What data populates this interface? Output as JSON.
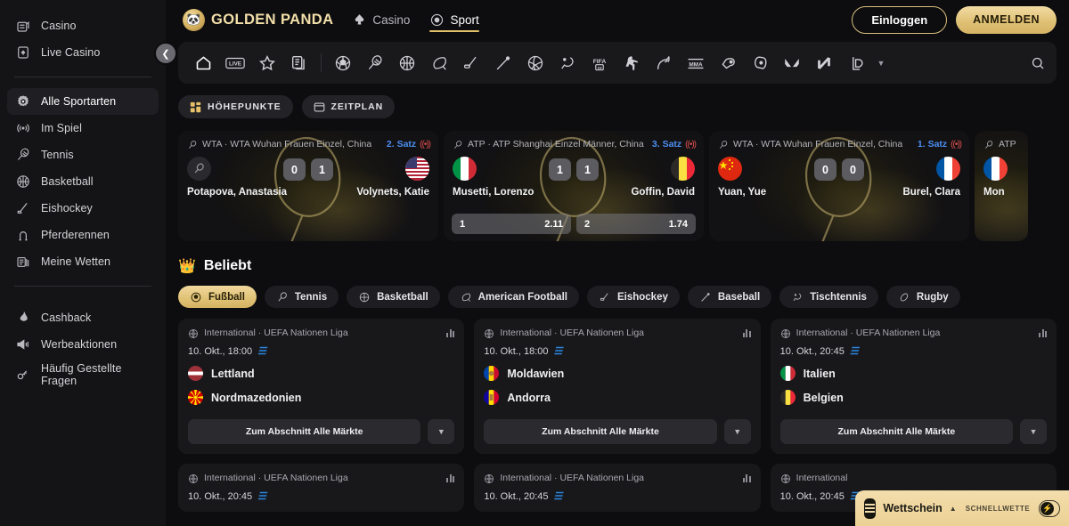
{
  "brand": {
    "name": "GOLDEN PANDA",
    "mark_icon": "panda-icon"
  },
  "topnav": [
    {
      "label": "Casino",
      "icon": "spade-icon",
      "selected": false
    },
    {
      "label": "Sport",
      "icon": "sport-target-icon",
      "selected": true
    }
  ],
  "auth": {
    "login": "Einloggen",
    "register": "ANMELDEN"
  },
  "sidebar": {
    "top": [
      {
        "label": "Casino",
        "icon": "slot-machine-icon"
      },
      {
        "label": "Live Casino",
        "icon": "spade-card-icon"
      }
    ],
    "sports": [
      {
        "label": "Alle Sportarten",
        "icon": "all-sports-icon",
        "active": true
      },
      {
        "label": "Im Spiel",
        "icon": "live-broadcast-icon",
        "active": false
      },
      {
        "label": "Tennis",
        "icon": "tennis-racket-icon",
        "active": false
      },
      {
        "label": "Basketball",
        "icon": "basketball-icon",
        "active": false
      },
      {
        "label": "Eishockey",
        "icon": "ice-hockey-icon",
        "active": false
      },
      {
        "label": "Pferderennen",
        "icon": "horseshoe-icon",
        "active": false
      },
      {
        "label": "Meine Wetten",
        "icon": "my-bets-icon",
        "active": false
      }
    ],
    "bottom": [
      {
        "label": "Cashback",
        "icon": "flame-icon"
      },
      {
        "label": "Werbeaktionen",
        "icon": "megaphone-icon"
      },
      {
        "label": "Häufig Gestellte Fragen",
        "icon": "faq-key-icon"
      }
    ],
    "collapse_icon": "chevron-left-icon"
  },
  "sportstrip": {
    "icons": [
      "home-icon",
      "live-badge-icon",
      "star-icon",
      "documents-icon",
      "football-icon",
      "tennis-racket-icon",
      "basketball-icon",
      "american-football-icon",
      "ice-hockey-icon",
      "baseball-icon",
      "volleyball-icon",
      "table-tennis-icon",
      "fifa-icon",
      "counter-strike-icon",
      "horse-racing-icon",
      "mma-icon",
      "boxing-glove-icon",
      "esports-icon",
      "valorant-icon",
      "nba2k-icon",
      "league-of-legends-icon"
    ],
    "more_icon": "chevron-down-icon",
    "search_icon": "search-icon"
  },
  "view_tabs": [
    {
      "label": "HÖHEPUNKTE",
      "icon": "grid-icon",
      "active": true
    },
    {
      "label": "ZEITPLAN",
      "icon": "calendar-icon",
      "active": false
    }
  ],
  "live_matches": [
    {
      "league": "WTA · WTA Wuhan Frauen Einzel, China",
      "sport_icon": "tennis-racket-icon",
      "set": "2. Satz",
      "live_icon": "live-signal-icon",
      "home": {
        "name": "Potapova, Anastasia",
        "flag": "placeholder",
        "score": "0"
      },
      "away": {
        "name": "Volynets, Katie",
        "flag": "us",
        "score": "1"
      },
      "odds": []
    },
    {
      "league": "ATP · ATP Shanghai Einzel Männer, China",
      "sport_icon": "tennis-racket-icon",
      "set": "3. Satz",
      "live_icon": "live-signal-icon",
      "home": {
        "name": "Musetti, Lorenzo",
        "flag": "it",
        "score": "1"
      },
      "away": {
        "name": "Goffin, David",
        "flag": "be",
        "score": "1"
      },
      "odds": [
        {
          "label": "1",
          "value": "2.11"
        },
        {
          "label": "2",
          "value": "1.74"
        }
      ]
    },
    {
      "league": "WTA · WTA Wuhan Frauen Einzel, China",
      "sport_icon": "tennis-racket-icon",
      "set": "1. Satz",
      "live_icon": "live-signal-icon",
      "home": {
        "name": "Yuan, Yue",
        "flag": "cn",
        "score": "0"
      },
      "away": {
        "name": "Burel, Clara",
        "flag": "fr",
        "score": "0"
      },
      "odds": []
    },
    {
      "league": "ATP",
      "sport_icon": "tennis-racket-icon",
      "set": "",
      "live_icon": "",
      "home": {
        "name": "",
        "flag": "",
        "score": ""
      },
      "away": {
        "name": "Mon",
        "flag": "fr",
        "score": ""
      },
      "odds": []
    }
  ],
  "popular": {
    "title": "Beliebt",
    "crown_icon": "crown-icon",
    "sport_chips": [
      {
        "label": "Fußball",
        "icon": "football-icon",
        "active": true
      },
      {
        "label": "Tennis",
        "icon": "tennis-racket-icon",
        "active": false
      },
      {
        "label": "Basketball",
        "icon": "basketball-icon",
        "active": false
      },
      {
        "label": "American Football",
        "icon": "american-football-icon",
        "active": false
      },
      {
        "label": "Eishockey",
        "icon": "ice-hockey-icon",
        "active": false
      },
      {
        "label": "Baseball",
        "icon": "baseball-icon",
        "active": false
      },
      {
        "label": "Tischtennis",
        "icon": "table-tennis-icon",
        "active": false
      },
      {
        "label": "Rugby",
        "icon": "rugby-icon",
        "active": false
      }
    ],
    "all_markets_label": "Zum Abschnitt Alle Märkte",
    "matches": [
      {
        "league": "International · UEFA Nationen Liga",
        "date": "10. Okt., 18:00",
        "stream_icon": "stream-icon",
        "stats_icon": "stats-bars-icon",
        "home": {
          "name": "Lettland",
          "flag": "lv"
        },
        "away": {
          "name": "Nordmazedonien",
          "flag": "mk"
        }
      },
      {
        "league": "International · UEFA Nationen Liga",
        "date": "10. Okt., 18:00",
        "stream_icon": "stream-icon",
        "stats_icon": "stats-bars-icon",
        "home": {
          "name": "Moldawien",
          "flag": "md"
        },
        "away": {
          "name": "Andorra",
          "flag": "ad"
        }
      },
      {
        "league": "International · UEFA Nationen Liga",
        "date": "10. Okt., 20:45",
        "stream_icon": "stream-icon",
        "stats_icon": "stats-bars-icon",
        "home": {
          "name": "Italien",
          "flag": "it"
        },
        "away": {
          "name": "Belgien",
          "flag": "be"
        }
      },
      {
        "league": "International · UEFA Nationen Liga",
        "date": "10. Okt., 20:45",
        "stream_icon": "stream-icon",
        "stats_icon": "stats-bars-icon",
        "home": {
          "name": "",
          "flag": ""
        },
        "away": {
          "name": "",
          "flag": ""
        }
      },
      {
        "league": "International · UEFA Nationen Liga",
        "date": "10. Okt., 20:45",
        "stream_icon": "stream-icon",
        "stats_icon": "stats-bars-icon",
        "home": {
          "name": "",
          "flag": ""
        },
        "away": {
          "name": "",
          "flag": ""
        }
      },
      {
        "league": "International",
        "date": "10. Okt., 20:45",
        "stream_icon": "stream-icon",
        "stats_icon": "stats-bars-icon",
        "home": {
          "name": "",
          "flag": ""
        },
        "away": {
          "name": "",
          "flag": ""
        }
      }
    ]
  },
  "betslip": {
    "title": "Wettschein",
    "quick_label": "SCHNELLWETTE",
    "caret_icon": "chevron-up-icon",
    "list_icon": "betslip-list-icon",
    "toggle_icon": "bolt-icon",
    "toggle_on": false
  },
  "colors": {
    "gold": "#e0c275",
    "gold_text": "#f3dfaa",
    "blue": "#4c8ff0",
    "red_live": "#e05050",
    "bg": "#0d0d0f",
    "panel": "#141416",
    "card": "#18181b"
  }
}
